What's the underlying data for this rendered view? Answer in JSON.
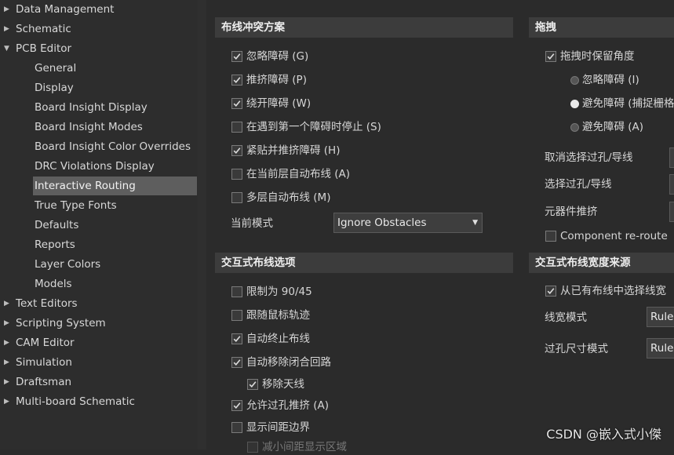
{
  "sidebar": {
    "items": [
      {
        "label": "Data Management",
        "level": 0,
        "expandable": true,
        "expanded": false,
        "selected": false
      },
      {
        "label": "Schematic",
        "level": 0,
        "expandable": true,
        "expanded": false,
        "selected": false
      },
      {
        "label": "PCB Editor",
        "level": 0,
        "expandable": true,
        "expanded": true,
        "selected": false
      },
      {
        "label": "General",
        "level": 1,
        "expandable": false,
        "selected": false
      },
      {
        "label": "Display",
        "level": 1,
        "expandable": false,
        "selected": false
      },
      {
        "label": "Board Insight Display",
        "level": 1,
        "expandable": false,
        "selected": false
      },
      {
        "label": "Board Insight Modes",
        "level": 1,
        "expandable": false,
        "selected": false
      },
      {
        "label": "Board Insight Color Overrides",
        "level": 1,
        "expandable": false,
        "selected": false
      },
      {
        "label": "DRC Violations Display",
        "level": 1,
        "expandable": false,
        "selected": false
      },
      {
        "label": "Interactive Routing",
        "level": 1,
        "expandable": false,
        "selected": true
      },
      {
        "label": "True Type Fonts",
        "level": 1,
        "expandable": false,
        "selected": false
      },
      {
        "label": "Defaults",
        "level": 1,
        "expandable": false,
        "selected": false
      },
      {
        "label": "Reports",
        "level": 1,
        "expandable": false,
        "selected": false
      },
      {
        "label": "Layer Colors",
        "level": 1,
        "expandable": false,
        "selected": false
      },
      {
        "label": "Models",
        "level": 1,
        "expandable": false,
        "selected": false
      },
      {
        "label": "Text Editors",
        "level": 0,
        "expandable": true,
        "expanded": false,
        "selected": false
      },
      {
        "label": "Scripting System",
        "level": 0,
        "expandable": true,
        "expanded": false,
        "selected": false
      },
      {
        "label": "CAM Editor",
        "level": 0,
        "expandable": true,
        "expanded": false,
        "selected": false
      },
      {
        "label": "Simulation",
        "level": 0,
        "expandable": true,
        "expanded": false,
        "selected": false
      },
      {
        "label": "Draftsman",
        "level": 0,
        "expandable": true,
        "expanded": false,
        "selected": false
      },
      {
        "label": "Multi-board Schematic",
        "level": 0,
        "expandable": true,
        "expanded": false,
        "selected": false
      }
    ]
  },
  "conflict": {
    "title": "布线冲突方案",
    "options": [
      {
        "label": "忽略障碍 (G)",
        "checked": true
      },
      {
        "label": "推挤障碍 (P)",
        "checked": true
      },
      {
        "label": "绕开障碍 (W)",
        "checked": true
      },
      {
        "label": "在遇到第一个障碍时停止 (S)",
        "checked": false
      },
      {
        "label": "紧贴并推挤障碍 (H)",
        "checked": true
      },
      {
        "label": "在当前层自动布线 (A)",
        "checked": false
      },
      {
        "label": "多层自动布线 (M)",
        "checked": false
      }
    ],
    "mode_label": "当前模式",
    "mode_value": "Ignore Obstacles"
  },
  "drag": {
    "title": "拖拽",
    "keep_angle_label": "拖拽时保留角度",
    "keep_angle_checked": true,
    "radios": [
      {
        "label": "忽略障碍 (I)",
        "selected": false
      },
      {
        "label": "避免障碍 (捕捉栅格",
        "selected": true
      },
      {
        "label": "避免障碍 (A)",
        "selected": false
      }
    ],
    "fields": [
      {
        "label": "取消选择过孔/导线"
      },
      {
        "label": "选择过孔/导线"
      },
      {
        "label": "元器件推挤"
      }
    ],
    "reroute_label": "Component re-route",
    "reroute_checked": false
  },
  "interactive": {
    "title": "交互式布线选项",
    "options": [
      {
        "label": "限制为 90/45",
        "checked": false,
        "indent": 0
      },
      {
        "label": "跟随鼠标轨迹",
        "checked": false,
        "indent": 0
      },
      {
        "label": "自动终止布线",
        "checked": true,
        "indent": 0
      },
      {
        "label": "自动移除闭合回路",
        "checked": true,
        "indent": 0
      },
      {
        "label": "移除天线",
        "checked": true,
        "indent": 1
      },
      {
        "label": "允许过孔推挤 (A)",
        "checked": true,
        "indent": 0
      },
      {
        "label": "显示间距边界",
        "checked": false,
        "indent": 0
      },
      {
        "label": "减小间距显示区域",
        "checked": false,
        "indent": 1,
        "disabled": true
      }
    ]
  },
  "width_source": {
    "title": "交互式布线宽度来源",
    "pick_label": "从已有布线中选择线宽",
    "pick_checked": true,
    "fields": [
      {
        "label": "线宽模式",
        "value": "Rule"
      },
      {
        "label": "过孔尺寸模式",
        "value": "Rule"
      }
    ]
  },
  "watermark": "CSDN @嵌入式小傑",
  "icons": {
    "collapsed": "triangle-right-icon",
    "expanded": "triangle-down-icon",
    "check": "check-icon",
    "dropdown": "caret-down-icon"
  },
  "colors": {
    "background": "#2b2b2b",
    "section_header": "#3c3c3c",
    "selection": "#5e5e5e",
    "text": "#d6d6d6"
  }
}
